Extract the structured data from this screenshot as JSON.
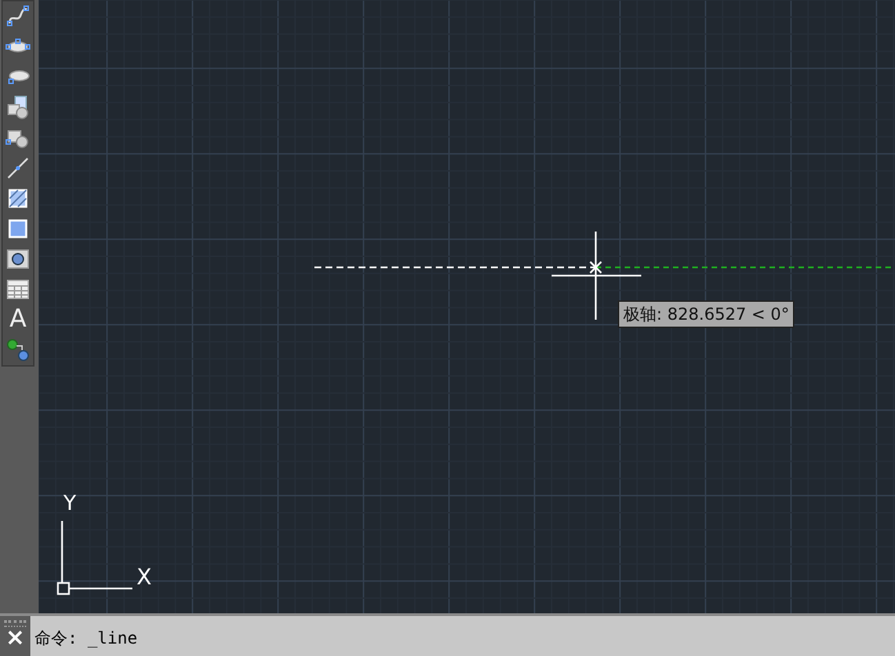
{
  "toolbar": {
    "tools": [
      {
        "kind": "spline"
      },
      {
        "kind": "ellipse"
      },
      {
        "kind": "ellipse-arc"
      },
      {
        "kind": "insert-block"
      },
      {
        "kind": "make-block"
      },
      {
        "kind": "point"
      },
      {
        "kind": "hatch"
      },
      {
        "kind": "gradient"
      },
      {
        "kind": "region"
      },
      {
        "kind": "table"
      },
      {
        "kind": "text"
      },
      {
        "kind": "add-selected"
      }
    ]
  },
  "text_tool_label": "A",
  "tooltip": {
    "text": "极轴: 828.6527 < 0°"
  },
  "ucs": {
    "y_label": "Y",
    "x_label": "X"
  },
  "command_line": {
    "close": "×",
    "lines": [
      "命令: _line"
    ]
  }
}
